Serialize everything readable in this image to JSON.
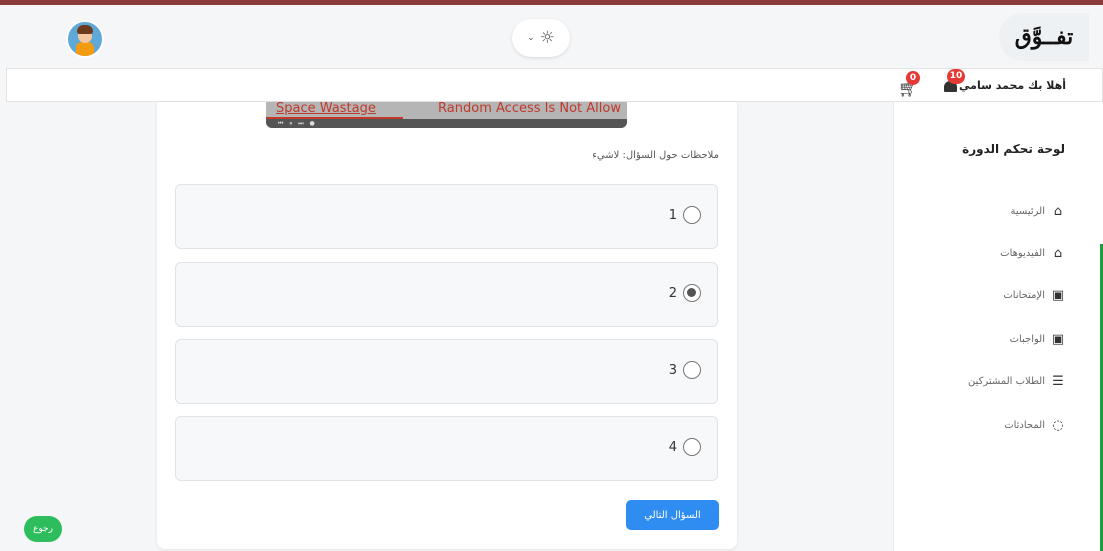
{
  "header": {
    "logo_text": "تفــوَّق",
    "theme_toggle": {
      "icon": "sun-icon",
      "chevron": "chevron-down-icon"
    }
  },
  "userbar": {
    "greeting": "أهلا بك محمد سامي",
    "notifications_count": "10",
    "cart_count": "0"
  },
  "sidebar": {
    "title": "لوحة تحكم الدورة",
    "items": [
      {
        "label": "الرئيسية",
        "icon": "home-icon"
      },
      {
        "label": "الفيديوهات",
        "icon": "home-icon"
      },
      {
        "label": "الإمتحانات",
        "icon": "clipboard-user-icon"
      },
      {
        "label": "الواجبات",
        "icon": "clipboard-user-icon"
      },
      {
        "label": "الطلاب المشتركين",
        "icon": "list-icon"
      },
      {
        "label": "المحادثات",
        "icon": "chat-icon"
      }
    ]
  },
  "video": {
    "text_left": "Space Wastage",
    "text_right": "Random Access Is Not Allow"
  },
  "question": {
    "notes": "ملاحظات حول السؤال: لاشيء",
    "options": [
      {
        "label": "1",
        "checked": false
      },
      {
        "label": "2",
        "checked": true
      },
      {
        "label": "3",
        "checked": false
      },
      {
        "label": "4",
        "checked": false
      }
    ],
    "next_label": "السؤال التالي"
  },
  "back_label": "رجوع",
  "colors": {
    "accent_blue": "#2f8cf0",
    "back_green": "#2ebd5c",
    "badge_red": "#e53935",
    "top_accent": "#8b3a3a"
  }
}
